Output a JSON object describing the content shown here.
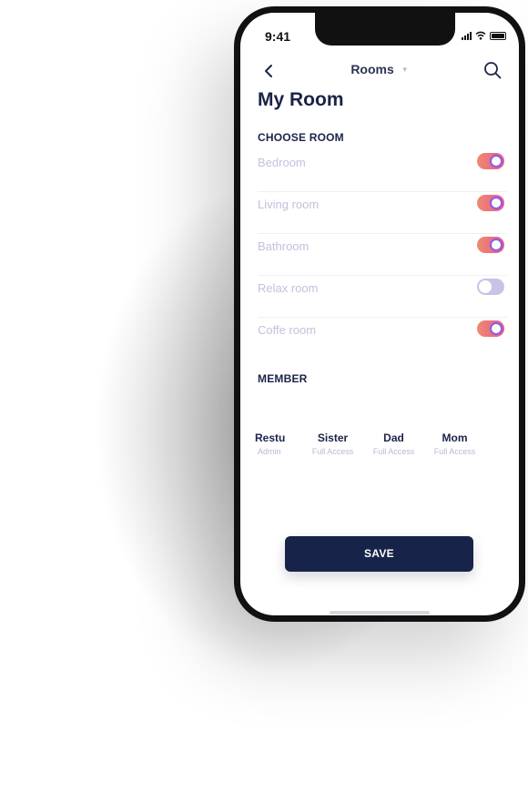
{
  "status_bar": {
    "time": "9:41"
  },
  "nav": {
    "title": "Rooms",
    "dropdown_caret": "▼"
  },
  "page": {
    "title": "My Room"
  },
  "choose_room": {
    "label": "CHOOSE ROOM",
    "rooms": [
      {
        "label": "Bedroom",
        "enabled": true
      },
      {
        "label": "Living room",
        "enabled": true
      },
      {
        "label": "Bathroom",
        "enabled": true
      },
      {
        "label": "Relax room",
        "enabled": false
      },
      {
        "label": "Coffe room",
        "enabled": true
      }
    ]
  },
  "member_section": {
    "label": "MEMBER",
    "members": [
      {
        "name": "Restu",
        "role": "Admin"
      },
      {
        "name": "Sister",
        "role": "Full Access"
      },
      {
        "name": "Dad",
        "role": "Full Access"
      },
      {
        "name": "Mom",
        "role": "Full Access"
      }
    ]
  },
  "actions": {
    "save_label": "SAVE"
  },
  "colors": {
    "primary": "#172348",
    "toggle_on_start": "#ee8a70",
    "toggle_on_end": "#e85a8e",
    "toggle_knob_ring": "#8b5be8",
    "toggle_off": "#c8c3e6",
    "muted_text": "#c3c0dc"
  },
  "icons": {
    "back": "chevron-left-icon",
    "search": "search-icon",
    "caret": "caret-down-icon"
  }
}
